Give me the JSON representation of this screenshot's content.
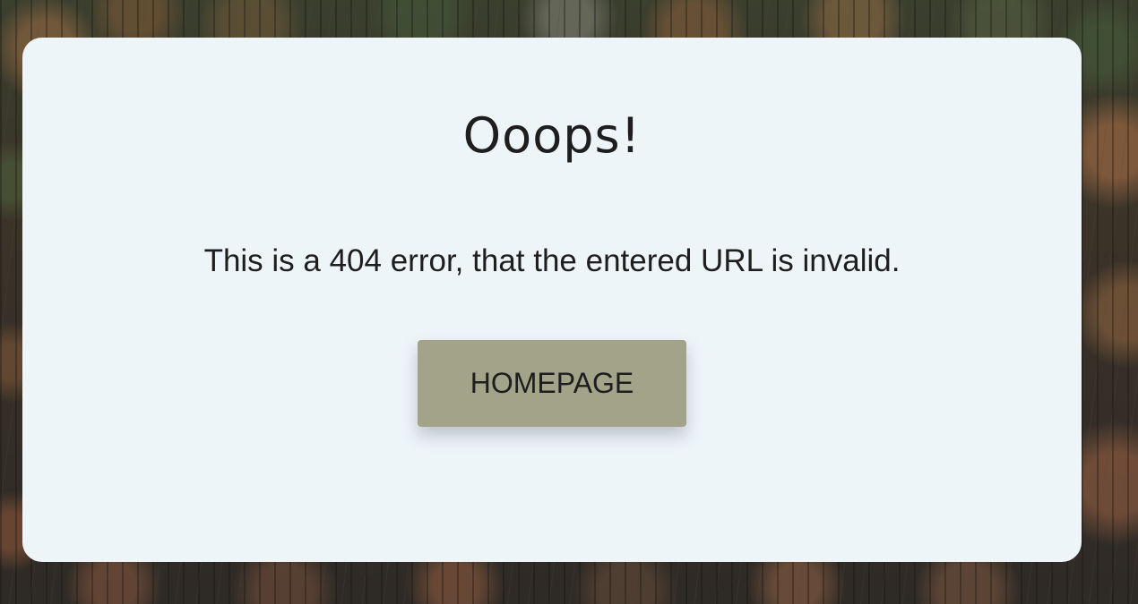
{
  "card": {
    "title": "Ooops!",
    "message": "This is a 404 error, that the entered URL is invalid.",
    "button_label": "HOMEPAGE"
  },
  "colors": {
    "card_background": "#eef5f9",
    "button_background": "#a3a38a",
    "text": "#1e1e1e"
  }
}
